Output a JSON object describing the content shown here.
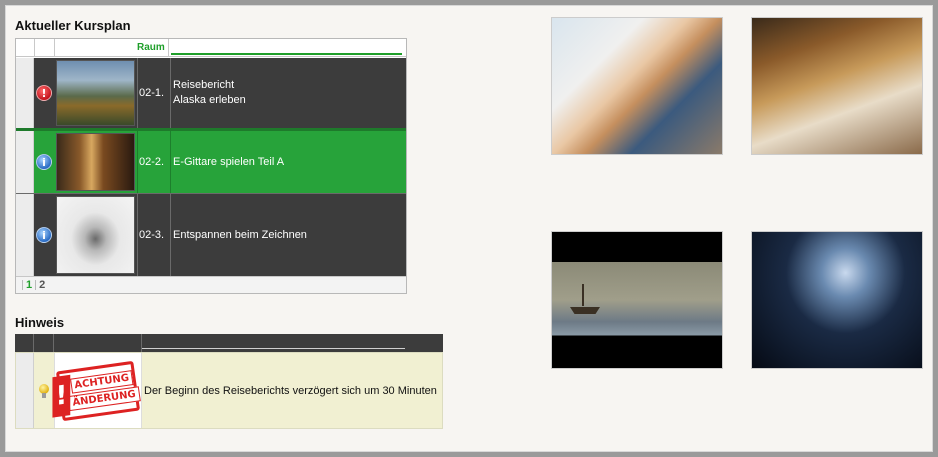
{
  "kursplan": {
    "title": "Aktueller Kursplan",
    "header_raum": "Raum",
    "rows": [
      {
        "status_icon": "warning-icon",
        "code": "02-1.",
        "title_line1": "Reisebericht",
        "title_line2": "Alaska erleben",
        "thumb": "alaska-landscape-image"
      },
      {
        "status_icon": "info-icon",
        "code": "02-2.",
        "title_line1": "E-Gittare spielen Teil A",
        "title_line2": "",
        "thumb": "guitar-image"
      },
      {
        "status_icon": "info-icon",
        "code": "02-3.",
        "title_line1": "Entspannen beim Zeichnen",
        "title_line2": "",
        "thumb": "lips-drawing-image"
      }
    ],
    "pager": {
      "current": "1",
      "next": "2"
    }
  },
  "hinweis": {
    "title": "Hinweis",
    "stamp_line1": "ACHTUNG",
    "stamp_line2": "ÄNDERUNG",
    "stamp_bang": "!",
    "message": "Der Beginn des Reiseberichts verzögert sich um 30 Minuten"
  },
  "colors": {
    "accent_green": "#27a33a",
    "row_dark": "#3c3c3c",
    "notice_bg": "#f1f0d2",
    "stamp_red": "#d22222"
  },
  "gallery": [
    {
      "name": "women-laptop-image"
    },
    {
      "name": "restaurant-table-image"
    },
    {
      "name": "fishing-boat-image"
    },
    {
      "name": "concert-hall-image"
    }
  ]
}
